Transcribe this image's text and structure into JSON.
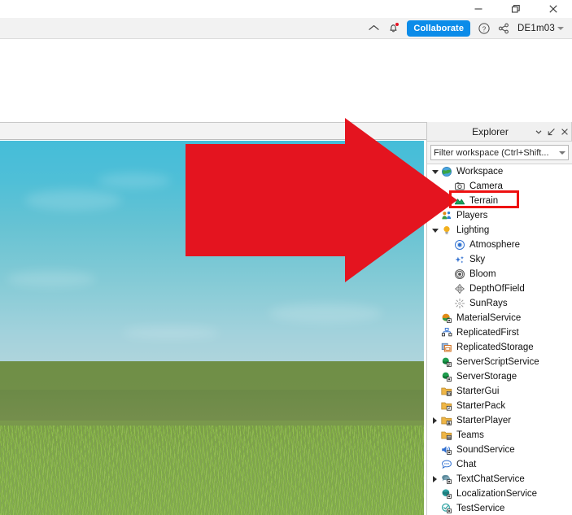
{
  "window": {
    "controls": [
      {
        "name": "minimize",
        "glyph": "minimize-icon"
      },
      {
        "name": "maximize",
        "glyph": "restore-icon"
      },
      {
        "name": "close",
        "glyph": "close-icon"
      }
    ]
  },
  "topbar": {
    "home_icon": "home-icon",
    "notifications_icon": "bell-icon",
    "has_notification_dot": true,
    "collaborate_label": "Collaborate",
    "collaborate_color": "#0c8ce9",
    "help_icon": "question-circle-icon",
    "share_icon": "share-icon",
    "username": "DE1m03",
    "account_caret": "chevron-down-icon"
  },
  "explorer": {
    "title": "Explorer",
    "header_buttons": [
      {
        "name": "explorer-menu-chevron",
        "glyph": "chevron-down-icon"
      },
      {
        "name": "explorer-undock",
        "glyph": "undock-icon"
      },
      {
        "name": "explorer-close",
        "glyph": "close-icon"
      }
    ],
    "filter_placeholder": "Filter workspace (Ctrl+Shift...",
    "filter_value": "Filter workspace (Ctrl+Shift...",
    "tree": [
      {
        "label": "Workspace",
        "depth": 0,
        "twisty": "down",
        "icon": "workspace-globe-icon",
        "selected": false
      },
      {
        "label": "Camera",
        "depth": 1,
        "twisty": "none",
        "icon": "camera-icon",
        "selected": false
      },
      {
        "label": "Terrain",
        "depth": 1,
        "twisty": "none",
        "icon": "terrain-icon",
        "selected": true
      },
      {
        "label": "Players",
        "depth": 0,
        "twisty": "none",
        "icon": "players-icon",
        "selected": false
      },
      {
        "label": "Lighting",
        "depth": 0,
        "twisty": "down",
        "icon": "lighting-bulb-icon",
        "selected": false
      },
      {
        "label": "Atmosphere",
        "depth": 1,
        "twisty": "none",
        "icon": "atmosphere-icon",
        "selected": false
      },
      {
        "label": "Sky",
        "depth": 1,
        "twisty": "none",
        "icon": "sky-stars-icon",
        "selected": false
      },
      {
        "label": "Bloom",
        "depth": 1,
        "twisty": "none",
        "icon": "bloom-icon",
        "selected": false
      },
      {
        "label": "DepthOfField",
        "depth": 1,
        "twisty": "none",
        "icon": "depth-of-field-icon",
        "selected": false
      },
      {
        "label": "SunRays",
        "depth": 1,
        "twisty": "none",
        "icon": "sunrays-icon",
        "selected": false
      },
      {
        "label": "MaterialService",
        "depth": 0,
        "twisty": "none",
        "icon": "material-service-icon",
        "selected": false
      },
      {
        "label": "ReplicatedFirst",
        "depth": 0,
        "twisty": "none",
        "icon": "replicated-first-icon",
        "selected": false
      },
      {
        "label": "ReplicatedStorage",
        "depth": 0,
        "twisty": "none",
        "icon": "replicated-storage-icon",
        "selected": false
      },
      {
        "label": "ServerScriptService",
        "depth": 0,
        "twisty": "none",
        "icon": "server-script-service-icon",
        "selected": false
      },
      {
        "label": "ServerStorage",
        "depth": 0,
        "twisty": "none",
        "icon": "server-storage-icon",
        "selected": false
      },
      {
        "label": "StarterGui",
        "depth": 0,
        "twisty": "none",
        "icon": "starter-gui-folder-icon",
        "selected": false
      },
      {
        "label": "StarterPack",
        "depth": 0,
        "twisty": "none",
        "icon": "starter-pack-folder-icon",
        "selected": false
      },
      {
        "label": "StarterPlayer",
        "depth": 0,
        "twisty": "right",
        "icon": "starter-player-folder-icon",
        "selected": false
      },
      {
        "label": "Teams",
        "depth": 0,
        "twisty": "none",
        "icon": "teams-folder-icon",
        "selected": false
      },
      {
        "label": "SoundService",
        "depth": 0,
        "twisty": "none",
        "icon": "sound-service-icon",
        "selected": false
      },
      {
        "label": "Chat",
        "depth": 0,
        "twisty": "none",
        "icon": "chat-bubble-icon",
        "selected": false
      },
      {
        "label": "TextChatService",
        "depth": 0,
        "twisty": "right",
        "icon": "text-chat-service-icon",
        "selected": false
      },
      {
        "label": "LocalizationService",
        "depth": 0,
        "twisty": "none",
        "icon": "localization-service-icon",
        "selected": false
      },
      {
        "label": "TestService",
        "depth": 0,
        "twisty": "none",
        "icon": "test-service-icon",
        "selected": false
      }
    ]
  },
  "annotations": {
    "arrow_color": "#e4141f",
    "arrow_direction": "right",
    "arrow_points_to": "Terrain",
    "highlight_color": "#ee1111",
    "highlight_target": "Terrain"
  },
  "viewport": {
    "scene": "grass-terrain-with-sky",
    "sky_top_color": "#45bdd9",
    "sky_horizon_color": "#aed4dc",
    "ground_color": "#7a9a4c"
  }
}
